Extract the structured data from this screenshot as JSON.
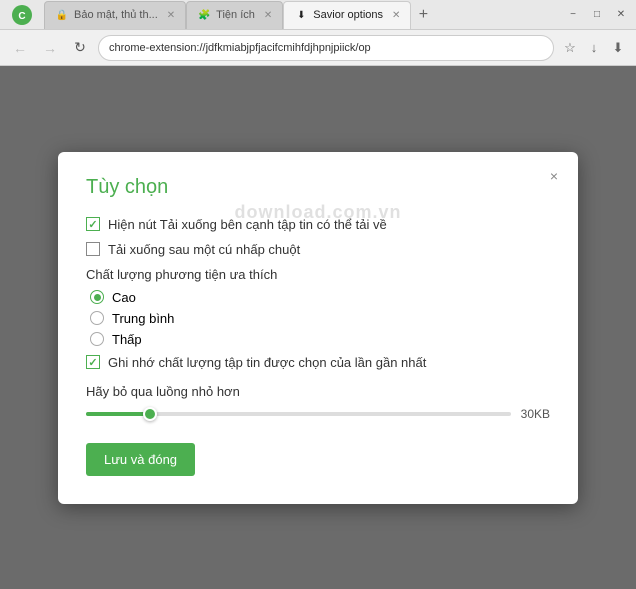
{
  "window": {
    "title": "Savior options",
    "minimize_label": "−",
    "maximize_label": "□",
    "close_label": "✕"
  },
  "tabs": [
    {
      "id": "tab-baomathu",
      "label": "Bảo mật, thủ th...",
      "active": false,
      "favicon": "🔒"
    },
    {
      "id": "tab-tienich",
      "label": "Tiện ích",
      "active": false,
      "favicon": "🧩"
    },
    {
      "id": "tab-savior",
      "label": "Savior options",
      "active": true,
      "favicon": "⬇"
    }
  ],
  "new_tab_icon": "+",
  "address_bar": {
    "url": "chrome-extension://jdfkmiabjpfjacifcmihfdjhpnjpiick/op",
    "back_disabled": true,
    "forward_disabled": true
  },
  "dialog": {
    "title": "Tùy chọn",
    "close_icon": "×",
    "options": [
      {
        "id": "opt-hien-nut",
        "type": "checkbox",
        "checked": true,
        "label": "Hiện nút Tải xuống bên cạnh tập tin có thể tải về"
      },
      {
        "id": "opt-tai-xuong",
        "type": "checkbox",
        "checked": false,
        "label": "Tải xuống sau một cú nhấp chuột"
      }
    ],
    "quality_section": {
      "label": "Chất lượng phương tiện ưa thích",
      "options": [
        {
          "id": "q-cao",
          "label": "Cao",
          "selected": true
        },
        {
          "id": "q-trung-binh",
          "label": "Trung bình",
          "selected": false
        },
        {
          "id": "q-thap",
          "label": "Thấp",
          "selected": false
        }
      ]
    },
    "remember_quality": {
      "id": "opt-ghi-nho",
      "type": "checkbox",
      "checked": true,
      "label": "Ghi nhớ chất lượng tập tin được chọn của lần gần nhất"
    },
    "slider": {
      "label": "Hãy bỏ qua luồng nhỏ hơn",
      "value": "30KB",
      "percent": 15
    },
    "save_button": "Lưu và đóng"
  }
}
